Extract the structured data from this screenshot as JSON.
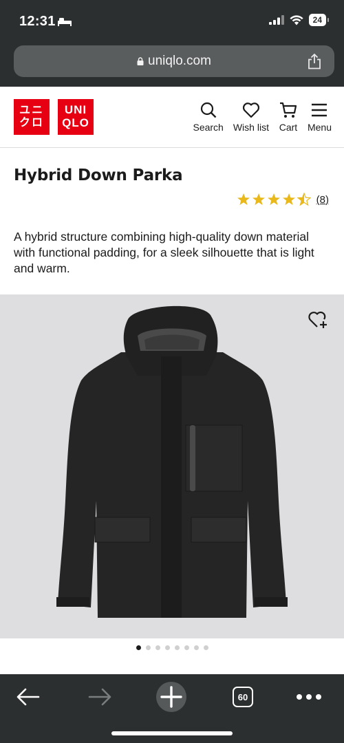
{
  "status_bar": {
    "time": "12:31",
    "battery": "24"
  },
  "browser": {
    "url": "uniqlo.com",
    "tabs_count": "60"
  },
  "brand": {
    "logo_jp_line1": "ユニ",
    "logo_jp_line2": "クロ",
    "logo_en_line1": "UNI",
    "logo_en_line2": "QLO",
    "accent_color": "#e60012"
  },
  "nav": {
    "search": "Search",
    "wishlist": "Wish list",
    "cart": "Cart",
    "menu": "Menu"
  },
  "product": {
    "title": "Hybrid Down Parka",
    "rating": 4.5,
    "review_count": "(8)",
    "description": "A hybrid structure combining high-quality down material with functional padding, for a sleek silhouette that is light and warm.",
    "image_count": 8,
    "active_image": 0
  },
  "icons": {
    "lock": "lock-icon",
    "share": "share-icon",
    "wishlist_add": "heart-plus-icon",
    "back": "arrow-left-icon",
    "forward": "arrow-right-icon",
    "new_tab": "plus-icon",
    "more": "ellipsis-icon"
  }
}
